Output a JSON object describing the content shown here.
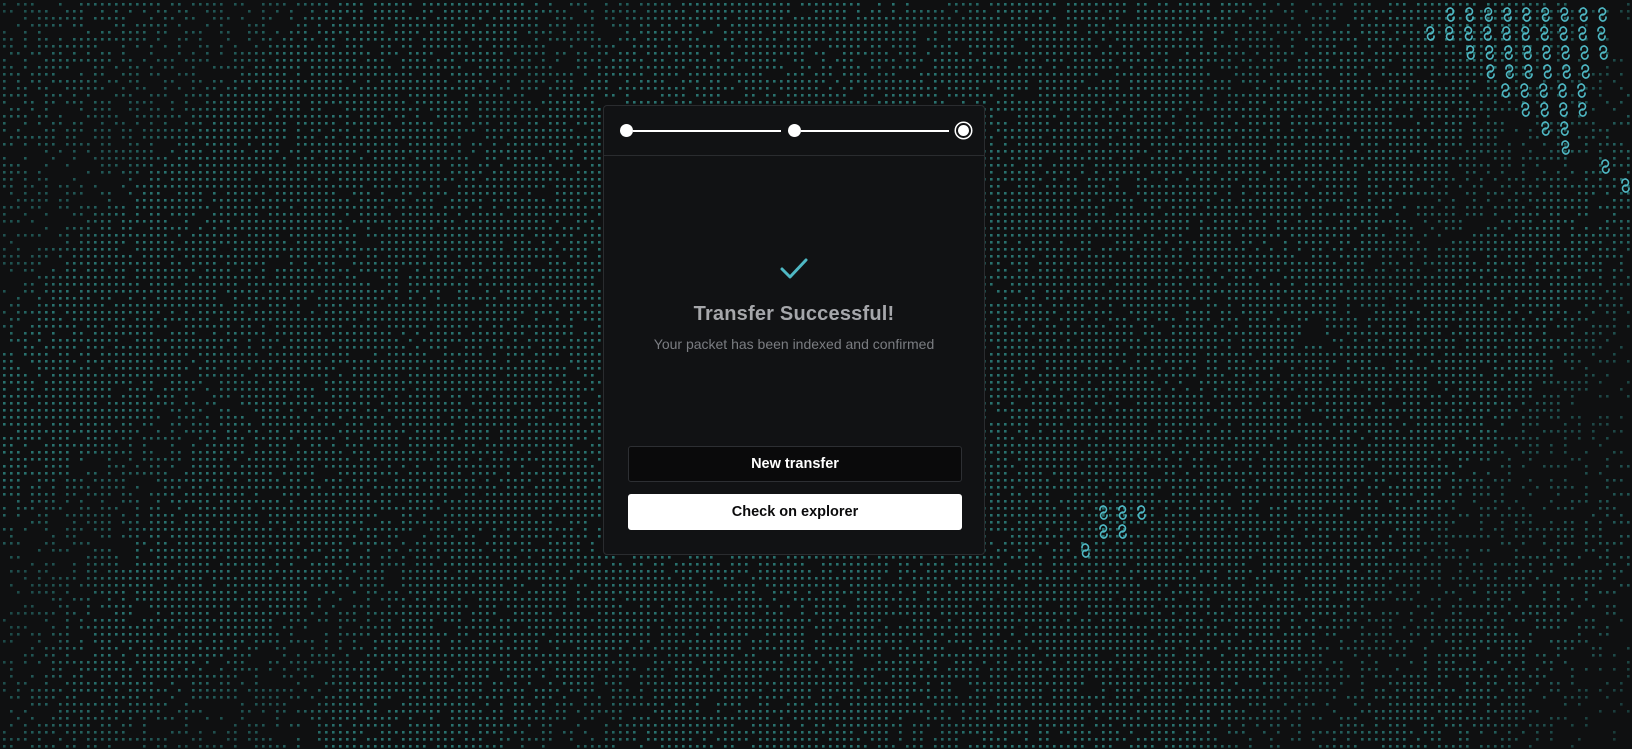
{
  "theme": {
    "background": "#0f1011",
    "dot_color": "#2f8a86",
    "link_icon_color": "#4fb8c4",
    "accent_check": "#4fb8c4",
    "card_background": "#111214"
  },
  "stepper": {
    "steps": 3,
    "current_step": 3
  },
  "result": {
    "icon": "checkmark-icon",
    "title": "Transfer Successful!",
    "subtitle": "Your packet has been indexed and confirmed"
  },
  "actions": {
    "new_transfer_label": "New transfer",
    "explorer_label": "Check on explorer"
  }
}
